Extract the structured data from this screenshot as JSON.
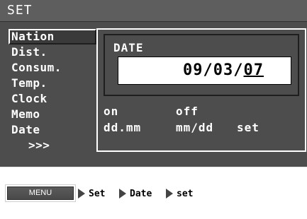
{
  "header": {
    "title": "SET"
  },
  "menu": {
    "items": [
      {
        "label": "Nation",
        "selected": true
      },
      {
        "label": "Dist."
      },
      {
        "label": "Consum."
      },
      {
        "label": "Temp."
      },
      {
        "label": "Clock"
      },
      {
        "label": "Memo"
      },
      {
        "label": "Date"
      },
      {
        "label": ">>>"
      }
    ]
  },
  "date_panel": {
    "label": "DATE",
    "value_prefix": "09/03/",
    "value_underlined": "07"
  },
  "options": {
    "row1": {
      "a": "on",
      "b": "off"
    },
    "row2": {
      "a": "dd.mm",
      "b": "mm/dd",
      "c": "set"
    }
  },
  "footer": {
    "menu_button": "MENU",
    "steps": [
      "Set",
      "Date",
      "set"
    ]
  },
  "colors": {
    "screen_bg": "#4d4d4d",
    "header_bg": "#5e5e5e",
    "text": "#ffffff",
    "date_box_bg": "#ffffff"
  }
}
